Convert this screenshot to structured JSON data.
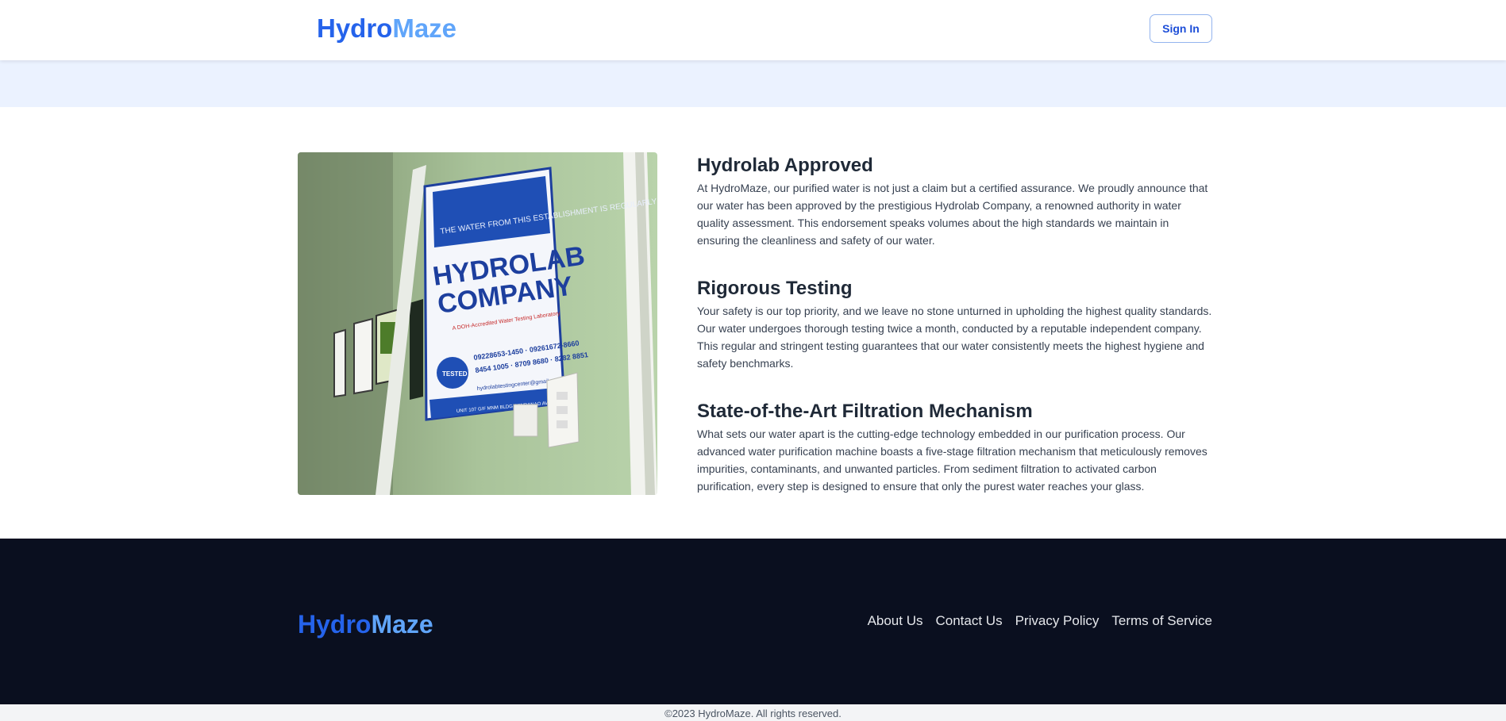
{
  "header": {
    "logo_part1": "Hydro",
    "logo_part2": "Maze",
    "signin_label": "Sign In"
  },
  "features": [
    {
      "title": "Hydrolab Approved",
      "text": "At HydroMaze, our purified water is not just a claim but a certified assurance. We proudly announce that our water has been approved by the prestigious Hydrolab Company, a renowned authority in water quality assessment. This endorsement speaks volumes about the high standards we maintain in ensuring the cleanliness and safety of our water."
    },
    {
      "title": "Rigorous Testing",
      "text": "Your safety is our top priority, and we leave no stone unturned in upholding the highest quality standards. Our water undergoes thorough testing twice a month, conducted by a reputable independent company. This regular and stringent testing guarantees that our water consistently meets the highest hygiene and safety benchmarks."
    },
    {
      "title": "State-of-the-Art Filtration Mechanism",
      "text": "What sets our water apart is the cutting-edge technology embedded in our purification process. Our advanced water purification machine boasts a five-stage filtration mechanism that meticulously removes impurities, contaminants, and unwanted particles. From sediment filtration to activated carbon purification, every step is designed to ensure that only the purest water reaches your glass."
    }
  ],
  "photo": {
    "sign_text": {
      "intro": "THE WATER FROM THIS ESTABLISHMENT IS REGULARLY TESTED AND STRICTLY MONITORED BY:",
      "brand_line1": "HYDROLAB",
      "brand_line2": "COMPANY",
      "subtitle": "A DOH-Accredited Water Testing Laboratory",
      "phone1": "09228653-1450 · 09261672-8660",
      "phone2": "8454 1005 · 8709 8680 · 8282 8851",
      "email": "hydrolabtestingcenter@gmail.com",
      "address": "UNIT 107 G/F MNM BLDG. MINDANAO AVE., Q.C",
      "seal": "TESTED"
    }
  },
  "footer": {
    "logo_part1": "Hydro",
    "logo_part2": "Maze",
    "links": [
      "About Us",
      "Contact Us",
      "Privacy Policy",
      "Terms of Service"
    ],
    "copyright": "©2023 HydroMaze. All rights reserved."
  },
  "colors": {
    "brand_primary": "#2563eb",
    "brand_light": "#60a5fa",
    "band": "#ebf2ff",
    "footer_bg": "#0a0f1f"
  }
}
